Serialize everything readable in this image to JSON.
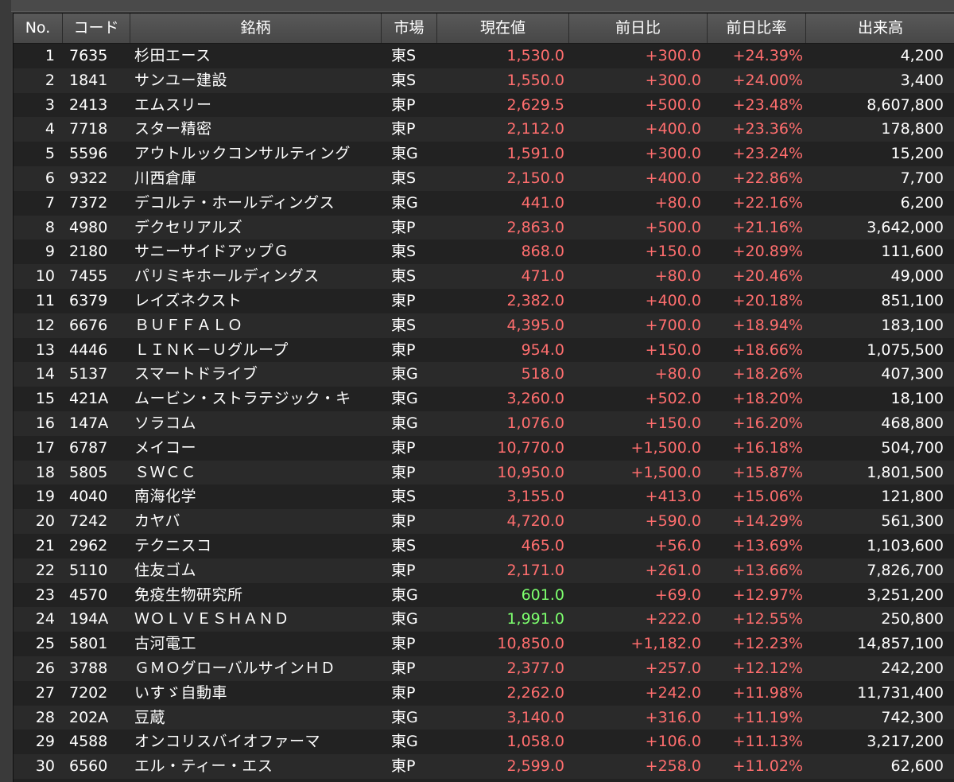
{
  "columns": [
    "No.",
    "コード",
    "銘柄",
    "市場",
    "現在値",
    "前日比",
    "前日比率",
    "出来高"
  ],
  "colors": {
    "up": "#ff6e6e",
    "highlight": "#7dff6e"
  },
  "rows": [
    {
      "no": "1",
      "code": "7635",
      "name": "杉田エース",
      "market": "東S",
      "price": "1,530.0",
      "change": "+300.0",
      "pct": "+24.39%",
      "volume": "4,200"
    },
    {
      "no": "2",
      "code": "1841",
      "name": "サンユー建設",
      "market": "東S",
      "price": "1,550.0",
      "change": "+300.0",
      "pct": "+24.00%",
      "volume": "3,400"
    },
    {
      "no": "3",
      "code": "2413",
      "name": "エムスリー",
      "market": "東P",
      "price": "2,629.5",
      "change": "+500.0",
      "pct": "+23.48%",
      "volume": "8,607,800"
    },
    {
      "no": "4",
      "code": "7718",
      "name": "スター精密",
      "market": "東P",
      "price": "2,112.0",
      "change": "+400.0",
      "pct": "+23.36%",
      "volume": "178,800"
    },
    {
      "no": "5",
      "code": "5596",
      "name": "アウトルックコンサルティング",
      "market": "東G",
      "price": "1,591.0",
      "change": "+300.0",
      "pct": "+23.24%",
      "volume": "15,200"
    },
    {
      "no": "6",
      "code": "9322",
      "name": "川西倉庫",
      "market": "東S",
      "price": "2,150.0",
      "change": "+400.0",
      "pct": "+22.86%",
      "volume": "7,700"
    },
    {
      "no": "7",
      "code": "7372",
      "name": "デコルテ・ホールディングス",
      "market": "東G",
      "price": "441.0",
      "change": "+80.0",
      "pct": "+22.16%",
      "volume": "6,200"
    },
    {
      "no": "8",
      "code": "4980",
      "name": "デクセリアルズ",
      "market": "東P",
      "price": "2,863.0",
      "change": "+500.0",
      "pct": "+21.16%",
      "volume": "3,642,000"
    },
    {
      "no": "9",
      "code": "2180",
      "name": "サニーサイドアップＧ",
      "market": "東S",
      "price": "868.0",
      "change": "+150.0",
      "pct": "+20.89%",
      "volume": "111,600"
    },
    {
      "no": "10",
      "code": "7455",
      "name": "パリミキホールディングス",
      "market": "東S",
      "price": "471.0",
      "change": "+80.0",
      "pct": "+20.46%",
      "volume": "49,000"
    },
    {
      "no": "11",
      "code": "6379",
      "name": "レイズネクスト",
      "market": "東P",
      "price": "2,382.0",
      "change": "+400.0",
      "pct": "+20.18%",
      "volume": "851,100"
    },
    {
      "no": "12",
      "code": "6676",
      "name": "ＢＵＦＦＡＬＯ",
      "market": "東S",
      "price": "4,395.0",
      "change": "+700.0",
      "pct": "+18.94%",
      "volume": "183,100"
    },
    {
      "no": "13",
      "code": "4446",
      "name": "ＬＩＮＫ－Ｕグループ",
      "market": "東P",
      "price": "954.0",
      "change": "+150.0",
      "pct": "+18.66%",
      "volume": "1,075,500"
    },
    {
      "no": "14",
      "code": "5137",
      "name": "スマートドライブ",
      "market": "東G",
      "price": "518.0",
      "change": "+80.0",
      "pct": "+18.26%",
      "volume": "407,300"
    },
    {
      "no": "15",
      "code": "421A",
      "name": "ムービン・ストラテジック・キ",
      "market": "東G",
      "price": "3,260.0",
      "change": "+502.0",
      "pct": "+18.20%",
      "volume": "18,100"
    },
    {
      "no": "16",
      "code": "147A",
      "name": "ソラコム",
      "market": "東G",
      "price": "1,076.0",
      "change": "+150.0",
      "pct": "+16.20%",
      "volume": "468,800"
    },
    {
      "no": "17",
      "code": "6787",
      "name": "メイコー",
      "market": "東P",
      "price": "10,770.0",
      "change": "+1,500.0",
      "pct": "+16.18%",
      "volume": "504,700"
    },
    {
      "no": "18",
      "code": "5805",
      "name": "ＳＷＣＣ",
      "market": "東P",
      "price": "10,950.0",
      "change": "+1,500.0",
      "pct": "+15.87%",
      "volume": "1,801,500"
    },
    {
      "no": "19",
      "code": "4040",
      "name": "南海化学",
      "market": "東S",
      "price": "3,155.0",
      "change": "+413.0",
      "pct": "+15.06%",
      "volume": "121,800"
    },
    {
      "no": "20",
      "code": "7242",
      "name": "カヤバ",
      "market": "東P",
      "price": "4,720.0",
      "change": "+590.0",
      "pct": "+14.29%",
      "volume": "561,300"
    },
    {
      "no": "21",
      "code": "2962",
      "name": "テクニスコ",
      "market": "東S",
      "price": "465.0",
      "change": "+56.0",
      "pct": "+13.69%",
      "volume": "1,103,600"
    },
    {
      "no": "22",
      "code": "5110",
      "name": "住友ゴム",
      "market": "東P",
      "price": "2,171.0",
      "change": "+261.0",
      "pct": "+13.66%",
      "volume": "7,826,700"
    },
    {
      "no": "23",
      "code": "4570",
      "name": "免疫生物研究所",
      "market": "東G",
      "price": "601.0",
      "change": "+69.0",
      "pct": "+12.97%",
      "volume": "3,251,200",
      "price_highlight": true
    },
    {
      "no": "24",
      "code": "194A",
      "name": "ＷＯＬＶＥＳＨＡＮＤ",
      "market": "東G",
      "price": "1,991.0",
      "change": "+222.0",
      "pct": "+12.55%",
      "volume": "250,800",
      "price_highlight": true
    },
    {
      "no": "25",
      "code": "5801",
      "name": "古河電工",
      "market": "東P",
      "price": "10,850.0",
      "change": "+1,182.0",
      "pct": "+12.23%",
      "volume": "14,857,100"
    },
    {
      "no": "26",
      "code": "3788",
      "name": "ＧＭＯグローバルサインＨＤ",
      "market": "東P",
      "price": "2,377.0",
      "change": "+257.0",
      "pct": "+12.12%",
      "volume": "242,200"
    },
    {
      "no": "27",
      "code": "7202",
      "name": "いすゞ自動車",
      "market": "東P",
      "price": "2,262.0",
      "change": "+242.0",
      "pct": "+11.98%",
      "volume": "11,731,400"
    },
    {
      "no": "28",
      "code": "202A",
      "name": "豆蔵",
      "market": "東G",
      "price": "3,140.0",
      "change": "+316.0",
      "pct": "+11.19%",
      "volume": "742,300"
    },
    {
      "no": "29",
      "code": "4588",
      "name": "オンコリスバイオファーマ",
      "market": "東G",
      "price": "1,058.0",
      "change": "+106.0",
      "pct": "+11.13%",
      "volume": "3,217,200"
    },
    {
      "no": "30",
      "code": "6560",
      "name": "エル・ティー・エス",
      "market": "東P",
      "price": "2,599.0",
      "change": "+258.0",
      "pct": "+11.02%",
      "volume": "62,600"
    }
  ]
}
